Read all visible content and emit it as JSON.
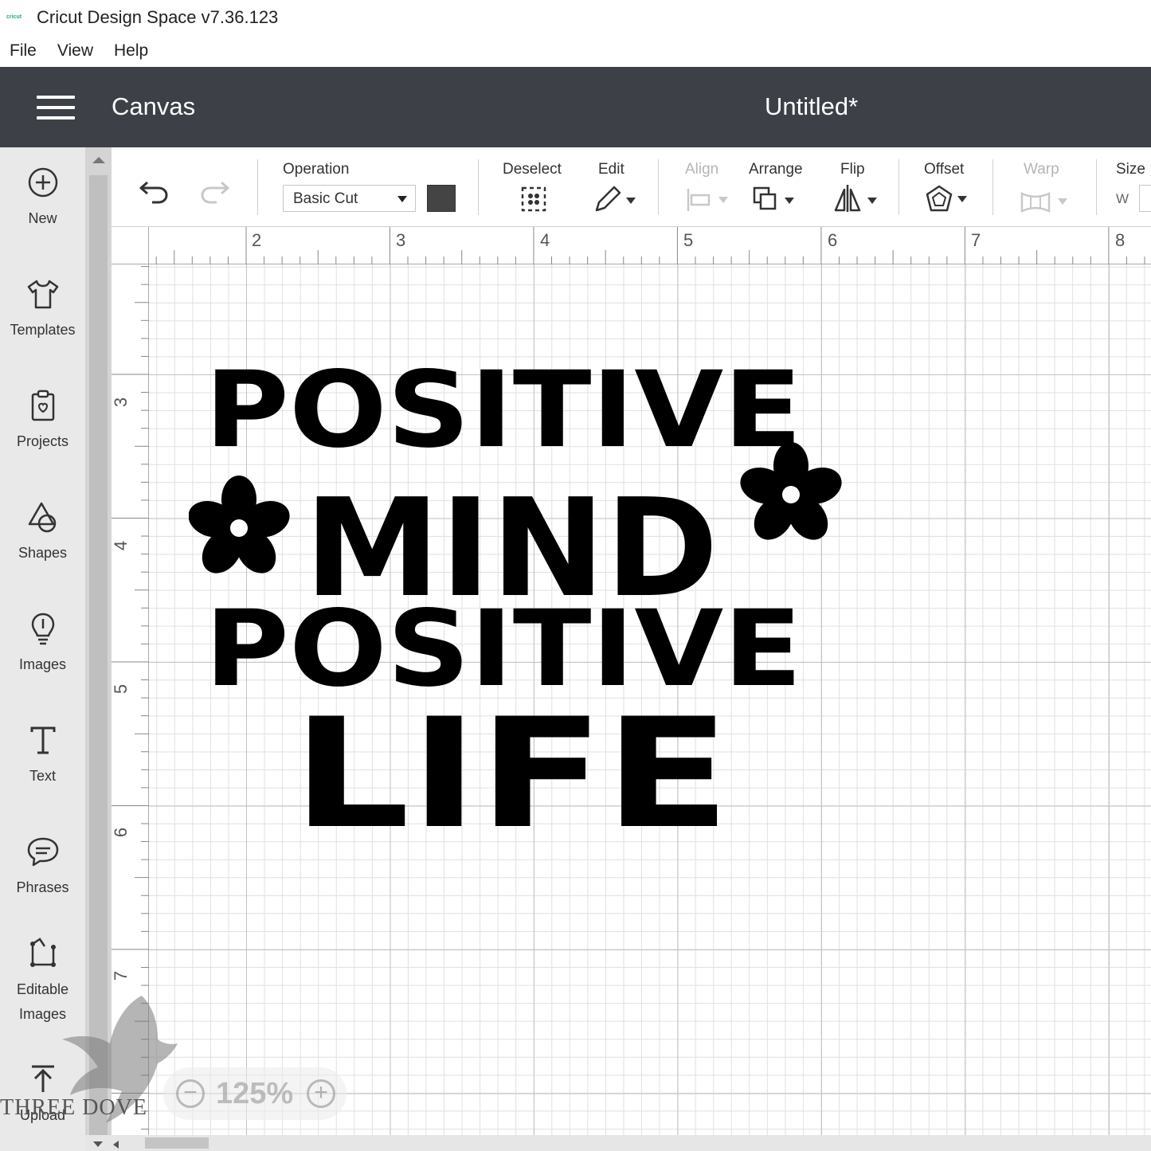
{
  "window": {
    "app_logo_text": "cricut",
    "title": "Cricut Design Space  v7.36.123"
  },
  "menu": [
    "File",
    "View",
    "Help"
  ],
  "header": {
    "section": "Canvas",
    "project_name": "Untitled*"
  },
  "sidebar": {
    "items": [
      {
        "label": "New",
        "icon": "plus-circle-icon"
      },
      {
        "label": "Templates",
        "icon": "tshirt-icon"
      },
      {
        "label": "Projects",
        "icon": "clipboard-icon"
      },
      {
        "label": "Shapes",
        "icon": "shapes-icon"
      },
      {
        "label": "Images",
        "icon": "lightbulb-icon"
      },
      {
        "label": "Text",
        "icon": "text-t-icon"
      },
      {
        "label": "Phrases",
        "icon": "speech-bubble-icon"
      },
      {
        "label": "Editable",
        "label2": "Images",
        "icon": "editable-image-icon"
      },
      {
        "label": "Upload",
        "icon": "upload-icon"
      }
    ]
  },
  "toolbar": {
    "operation_label": "Operation",
    "operation_value": "Basic Cut",
    "operation_color": "#444444",
    "deselect": "Deselect",
    "edit": "Edit",
    "align": "Align",
    "arrange": "Arrange",
    "flip": "Flip",
    "offset": "Offset",
    "warp": "Warp",
    "size": "Size",
    "size_w": "W",
    "align_enabled": false,
    "warp_enabled": false
  },
  "ruler": {
    "top": [
      "2",
      "2",
      "3",
      "4",
      "5",
      "6",
      "7",
      "8"
    ],
    "left": [
      "3",
      "4",
      "5",
      "6",
      "7"
    ]
  },
  "design": {
    "lines": [
      "POSITIVE",
      "MIND",
      "POSITIVE",
      "LIFE"
    ],
    "fill": "#000000"
  },
  "zoom": {
    "value": "125%",
    "minus": "−",
    "plus": "+"
  },
  "watermark": {
    "text": "THREE DOVE"
  }
}
